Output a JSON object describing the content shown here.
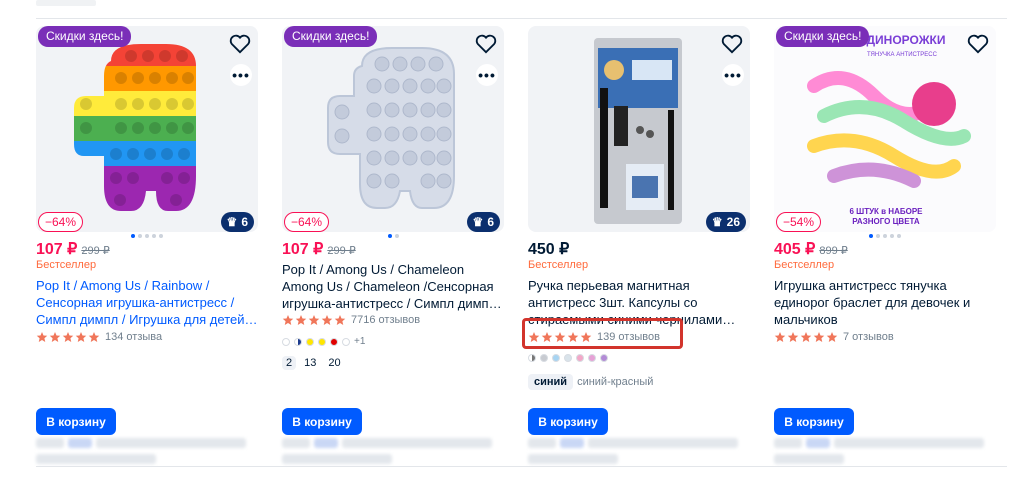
{
  "colors": {
    "accent": "#005bff",
    "sale": "#f91155",
    "promo": "#7a2eb8",
    "crown": "#0b2f6e",
    "star": "#f0765a",
    "highlight": "#d2342c"
  },
  "products": [
    {
      "promo": "Скидки здесь!",
      "discount": "−64%",
      "crown_count": "6",
      "price": "107 ₽",
      "old_price": "299 ₽",
      "tag": "Бестселлер",
      "title": "Pop It / Among Us / Rainbow / Сенсорная игрушка-антистресс / Симпл димпл / Игрушка для детей…",
      "reviews": "134 отзыва",
      "cart": "В корзину",
      "image": "rainbow-popit-image"
    },
    {
      "promo": "Скидки здесь!",
      "discount": "−64%",
      "crown_count": "6",
      "price": "107 ₽",
      "old_price": "299 ₽",
      "tag": "",
      "title": "Pop It / Among Us / Chameleon Among Us / Chameleon /Сенсорная игрушка-антистресс / Симпл димп…",
      "reviews": "7716 отзывов",
      "colors_more": "+1",
      "sizes": [
        "2",
        "13",
        "20"
      ],
      "cart": "В корзину",
      "image": "white-popit-image"
    },
    {
      "promo": "",
      "discount": "",
      "crown_count": "26",
      "price": "450 ₽",
      "old_price": "",
      "tag": "Бестселлер",
      "title": "Ручка перьевая магнитная антистресс 3шт. Капсулы со стираемыми синими чернилами…",
      "reviews": "139 отзывов",
      "chip_selected": "синий",
      "chip_other": "синий-красный",
      "cart": "В корзину",
      "image": "magnetic-pen-image"
    },
    {
      "promo": "Скидки здесь!",
      "discount": "−54%",
      "crown_count": "",
      "price": "405 ₽",
      "old_price": "899 ₽",
      "tag": "Бестселлер",
      "title": "Игрушка антистресс тянучка единорог браслет для девочек и мальчиков",
      "reviews": "7 отзывов",
      "cart": "В корзину",
      "image": "unicorn-stretch-image",
      "image_text": {
        "top": "ЕДИНОРОЖКИ",
        "sub": "ТЯНУЧКА АНТИСТРЕСС",
        "bottom1": "6 ШТУК в НАБОРЕ",
        "bottom2": "РАЗНОГО ЦВЕТА"
      }
    }
  ]
}
